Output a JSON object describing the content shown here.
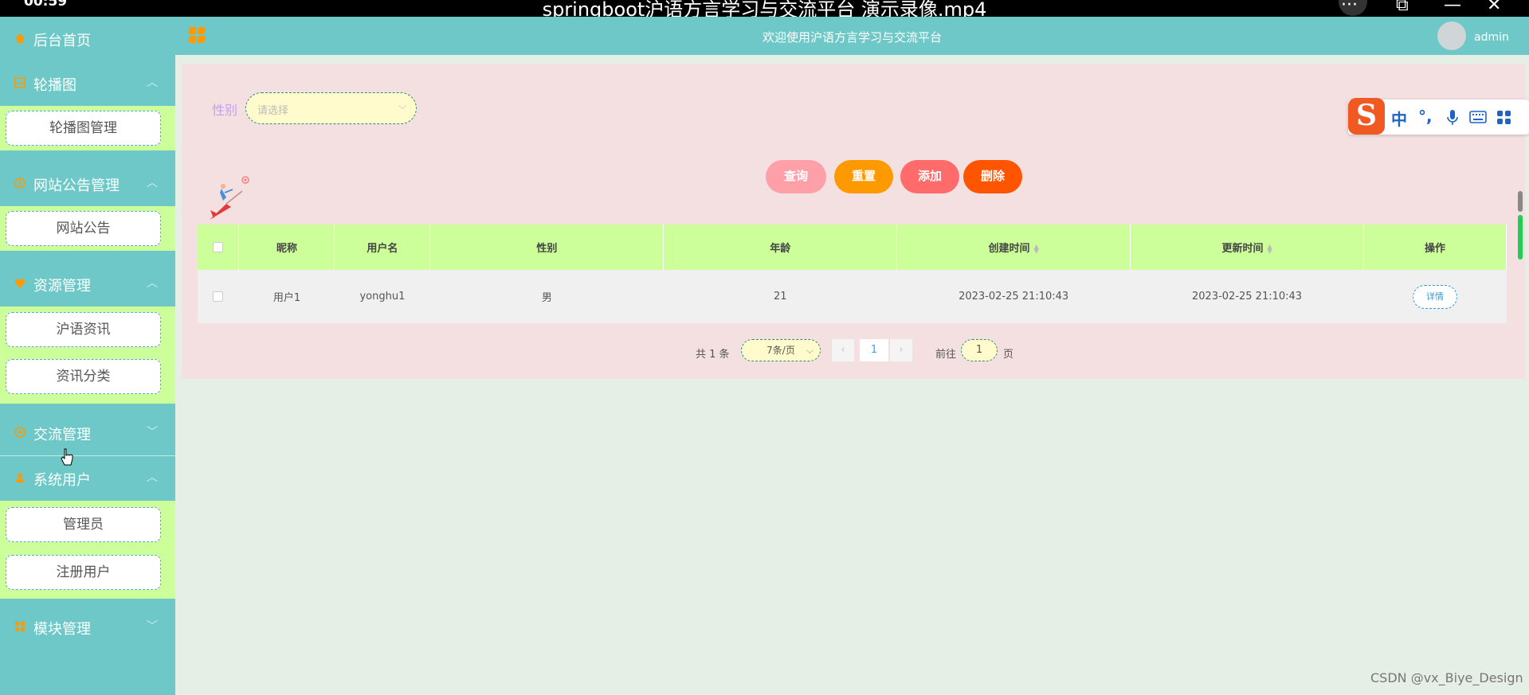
{
  "player": {
    "time": "00:59",
    "title": "springboot沪语方言学习与交流平台 演示录像.mp4",
    "controls": {
      "more": "···",
      "minimize": "—",
      "close": "✕"
    }
  },
  "header": {
    "title": "欢迎使用沪语方言学习与交流平台",
    "user": "admin"
  },
  "sidebar": {
    "home": "后台首页",
    "groups": [
      {
        "label": "轮播图",
        "icon": "image-icon",
        "items": [
          "轮播图管理"
        ]
      },
      {
        "label": "网站公告管理",
        "icon": "notice-icon",
        "items": [
          "网站公告"
        ]
      },
      {
        "label": "资源管理",
        "icon": "heart-icon",
        "items": [
          "沪语资讯",
          "资讯分类"
        ]
      },
      {
        "label": "交流管理",
        "icon": "chat-icon",
        "items": []
      },
      {
        "label": "系统用户",
        "icon": "user-icon",
        "items": [
          "管理员",
          "注册用户"
        ]
      },
      {
        "label": "模块管理",
        "icon": "grid-icon",
        "items": []
      }
    ]
  },
  "filter": {
    "label": "性别",
    "placeholder": "请选择"
  },
  "actions": {
    "query": "查询",
    "reset": "重置",
    "add": "添加",
    "delete": "删除"
  },
  "table": {
    "columns": [
      "昵称",
      "用户名",
      "性别",
      "年龄",
      "创建时间",
      "更新时间",
      "操作"
    ],
    "rows": [
      {
        "nickname": "用户1",
        "username": "yonghu1",
        "gender": "男",
        "age": "21",
        "created": "2023-02-25 21:10:43",
        "updated": "2023-02-25 21:10:43",
        "action": "详情"
      }
    ]
  },
  "pagination": {
    "total": "共 1 条",
    "page_size": "7条/页",
    "current": "1",
    "goto_label": "前往",
    "goto_value": "1",
    "page_suffix": "页",
    "prev": "‹",
    "next": "›"
  },
  "ime": {
    "logo": "S",
    "items": [
      "中",
      "°,",
      "mic-icon",
      "keyboard-icon",
      "apps-icon"
    ],
    "lang": "中",
    "punct": "°,"
  },
  "watermark": "CSDN @vx_Biye_Design",
  "colors": {
    "sidebar": "#6ec8c8",
    "submenu": "#ccff99",
    "panel": "#f4e0e0",
    "query": "#ffa0a8",
    "reset": "#ff9900",
    "add": "#ff6b6b",
    "delete": "#ff5500"
  }
}
